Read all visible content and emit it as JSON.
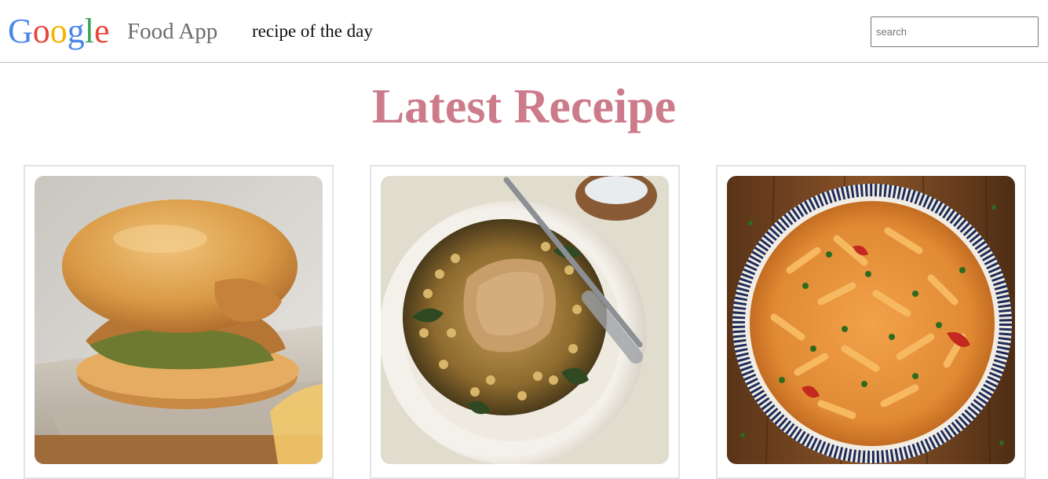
{
  "header": {
    "logo_letters": [
      {
        "char": "G",
        "color": "#4a86e8"
      },
      {
        "char": "o",
        "color": "#e8453c"
      },
      {
        "char": "o",
        "color": "#f4b400"
      },
      {
        "char": "g",
        "color": "#4a86e8"
      },
      {
        "char": "l",
        "color": "#3aa757"
      },
      {
        "char": "e",
        "color": "#e8453c"
      }
    ],
    "app_name": "Food App",
    "nav_link": "recipe of the day",
    "search": {
      "placeholder": "search",
      "value": ""
    }
  },
  "main": {
    "title": "Latest Receipe",
    "title_color": "#cc7b8a",
    "recipes": [
      {
        "image": "fried chicken sandwich"
      },
      {
        "image": "chicken with pearl couscous and greens"
      },
      {
        "image": "pasta in tomato cream sauce"
      }
    ]
  }
}
